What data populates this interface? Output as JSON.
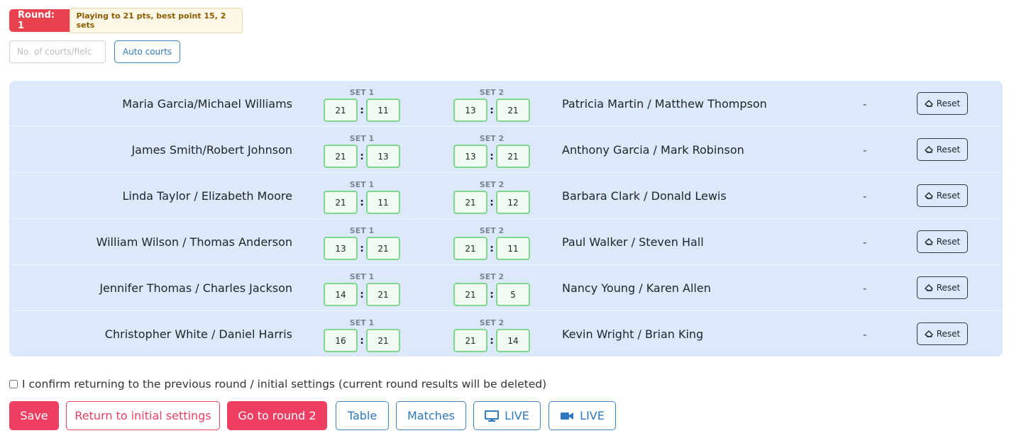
{
  "header": {
    "round_label": "Round: 1",
    "round_info": "Playing to 21 pts, best point 15, 2 sets"
  },
  "courts": {
    "placeholder": "No. of courts/fielc",
    "auto_label": "Auto courts"
  },
  "set_labels": [
    "SET 1",
    "SET 2"
  ],
  "reset_label": "Reset",
  "matches": [
    {
      "team_a": "Maria Garcia/Michael Williams",
      "team_b": "Patricia Martin / Matthew Thompson",
      "set1": [
        "21",
        "11"
      ],
      "set2": [
        "13",
        "21"
      ],
      "result": "-"
    },
    {
      "team_a": "James Smith/Robert Johnson",
      "team_b": "Anthony Garcia / Mark Robinson",
      "set1": [
        "21",
        "13"
      ],
      "set2": [
        "13",
        "21"
      ],
      "result": "-"
    },
    {
      "team_a": "Linda Taylor / Elizabeth Moore",
      "team_b": "Barbara Clark / Donald Lewis",
      "set1": [
        "21",
        "11"
      ],
      "set2": [
        "21",
        "12"
      ],
      "result": "-"
    },
    {
      "team_a": "William Wilson / Thomas Anderson",
      "team_b": "Paul Walker / Steven Hall",
      "set1": [
        "13",
        "21"
      ],
      "set2": [
        "21",
        "11"
      ],
      "result": "-"
    },
    {
      "team_a": "Jennifer Thomas / Charles Jackson",
      "team_b": "Nancy Young / Karen Allen",
      "set1": [
        "14",
        "21"
      ],
      "set2": [
        "21",
        "5"
      ],
      "result": "-"
    },
    {
      "team_a": "Christopher White / Daniel Harris",
      "team_b": "Kevin Wright / Brian King",
      "set1": [
        "16",
        "21"
      ],
      "set2": [
        "21",
        "14"
      ],
      "result": "-"
    }
  ],
  "confirm_text": "I confirm returning to the previous round / initial settings (current round results will be deleted)",
  "actions": {
    "save": "Save",
    "return": "Return to initial settings",
    "next_round": "Go to round 2",
    "table": "Table",
    "matches": "Matches",
    "live_screen": "LIVE",
    "live_video": "LIVE"
  },
  "colors": {
    "accent_red": "#ee3f63",
    "round_badge": "#e8424f",
    "primary_blue": "#2f78bd",
    "matches_bg": "#dbe9fb",
    "score_border": "#7fd68d"
  }
}
